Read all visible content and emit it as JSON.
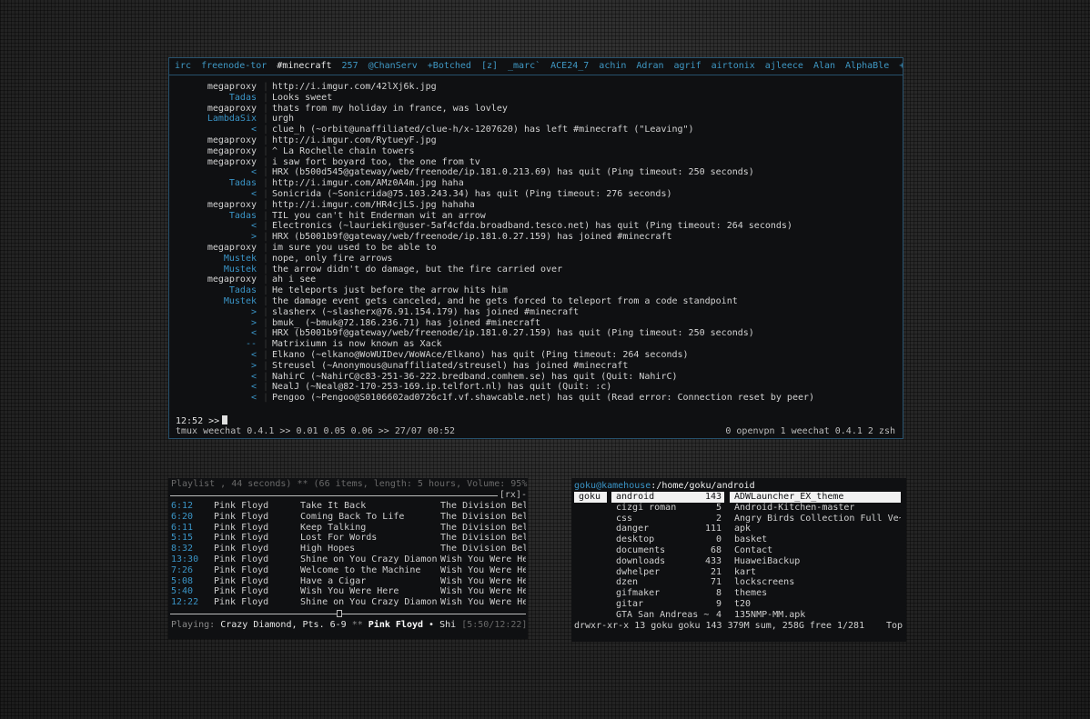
{
  "irc": {
    "topbar": [
      "irc",
      "freenode-tor",
      "#minecraft",
      "257",
      "@ChanServ",
      "+Botched",
      "[z]",
      "_marc`",
      "ACE24_7",
      "achin",
      "Adran",
      "agrif",
      "airtonix",
      "ajleece",
      "Alan",
      "AlphaBle",
      "++"
    ],
    "messages": [
      {
        "nick": "megaproxy",
        "nick_color": "std",
        "msg": "http://i.imgur.com/42lXj6k.jpg",
        "msg_color": "std"
      },
      {
        "nick": "Tadas",
        "nick_color": "blue",
        "msg": "Looks sweet",
        "msg_color": "std"
      },
      {
        "nick": "megaproxy",
        "nick_color": "std",
        "msg": "thats from my holiday in france, was lovley",
        "msg_color": "std"
      },
      {
        "nick": "LambdaSix",
        "nick_color": "blue",
        "msg": "urgh",
        "msg_color": "std"
      },
      {
        "nick": "<",
        "nick_color": "blue",
        "msg": "clue_h (~orbit@unaffiliated/clue-h/x-1207620) has left #minecraft (\"Leaving\")",
        "msg_color": "std"
      },
      {
        "nick": "megaproxy",
        "nick_color": "std",
        "msg": "http://i.imgur.com/RytueyF.jpg",
        "msg_color": "std"
      },
      {
        "nick": "megaproxy",
        "nick_color": "std",
        "msg": "^ La Rochelle chain towers",
        "msg_color": "std"
      },
      {
        "nick": "megaproxy",
        "nick_color": "std",
        "msg": "i saw fort boyard too, the one from tv",
        "msg_color": "std"
      },
      {
        "nick": "<",
        "nick_color": "blue",
        "msg": "HRX (b500d545@gateway/web/freenode/ip.181.0.213.69) has quit (Ping timeout: 250 seconds)",
        "msg_color": "std"
      },
      {
        "nick": "Tadas",
        "nick_color": "blue",
        "msg": "http://i.imgur.com/AMz0A4m.jpg haha",
        "msg_color": "std"
      },
      {
        "nick": "<",
        "nick_color": "blue",
        "msg": "Sonicrida (~Sonicrida@75.103.243.34) has quit (Ping timeout: 276 seconds)",
        "msg_color": "std"
      },
      {
        "nick": "megaproxy",
        "nick_color": "std",
        "msg": "http://i.imgur.com/HR4cjLS.jpg hahaha",
        "msg_color": "std"
      },
      {
        "nick": "Tadas",
        "nick_color": "blue",
        "msg": "TIL you can't hit Enderman wit an arrow",
        "msg_color": "std"
      },
      {
        "nick": "<",
        "nick_color": "blue",
        "msg": "Electronics (~lauriekir@user-5af4cfda.broadband.tesco.net) has quit (Ping timeout: 264 seconds)",
        "msg_color": "std"
      },
      {
        "nick": ">",
        "nick_color": "blue",
        "msg": "HRX (b5001b9f@gateway/web/freenode/ip.181.0.27.159) has joined #minecraft",
        "msg_color": "std"
      },
      {
        "nick": "megaproxy",
        "nick_color": "std",
        "msg": "im sure you used to be able to",
        "msg_color": "std"
      },
      {
        "nick": "Mustek",
        "nick_color": "blue",
        "msg": "nope, only fire arrows",
        "msg_color": "std"
      },
      {
        "nick": "Mustek",
        "nick_color": "blue",
        "msg": "the arrow didn't do damage, but the fire carried over",
        "msg_color": "std"
      },
      {
        "nick": "megaproxy",
        "nick_color": "std",
        "msg": "ah i see",
        "msg_color": "std"
      },
      {
        "nick": "Tadas",
        "nick_color": "blue",
        "msg": "He teleports just before the arrow hits him",
        "msg_color": "std"
      },
      {
        "nick": "Mustek",
        "nick_color": "blue",
        "msg": "the damage event gets canceled, and he gets forced to teleport from a code standpoint",
        "msg_color": "std"
      },
      {
        "nick": ">",
        "nick_color": "blue",
        "msg": "slasherx (~slasherx@76.91.154.179) has joined #minecraft",
        "msg_color": "std"
      },
      {
        "nick": ">",
        "nick_color": "blue",
        "msg": "bmuk_ (~bmuk@72.186.236.71) has joined #minecraft",
        "msg_color": "std"
      },
      {
        "nick": "<",
        "nick_color": "blue",
        "msg": "HRX (b5001b9f@gateway/web/freenode/ip.181.0.27.159) has quit (Ping timeout: 250 seconds)",
        "msg_color": "std"
      },
      {
        "nick": "--",
        "nick_color": "blue",
        "msg": "Matrixiumn is now known as Xack",
        "msg_color": "std"
      },
      {
        "nick": "<",
        "nick_color": "blue",
        "msg": "Elkano (~elkano@WoWUIDev/WoWAce/Elkano) has quit (Ping timeout: 264 seconds)",
        "msg_color": "std"
      },
      {
        "nick": ">",
        "nick_color": "blue",
        "msg": "Streusel (~Anonymous@unaffiliated/streusel) has joined #minecraft",
        "msg_color": "std"
      },
      {
        "nick": "<",
        "nick_color": "blue",
        "msg": "NahirC (~NahirC@c83-251-36-222.bredband.comhem.se) has quit (Quit: NahirC)",
        "msg_color": "std"
      },
      {
        "nick": "<",
        "nick_color": "blue",
        "msg": "NealJ (~Neal@82-170-253-169.ip.telfort.nl) has quit (Quit: :c)",
        "msg_color": "std"
      },
      {
        "nick": "<",
        "nick_color": "blue",
        "msg": "Pengoo (~Pengoo@S0106602ad0726c1f.vf.shawcable.net) has quit (Read error: Connection reset by peer)",
        "msg_color": "std"
      }
    ],
    "input_prompt": "12:52 >>",
    "status_left": "tmux weechat 0.4.1 >> 0.01 0.05 0.06 >> 27/07 00:52",
    "status_right": "0 openvpn 1 weechat 0.4.1 2 zsh"
  },
  "mpd": {
    "header": "Playlist , 44 seconds) ** (66 items, length: 5 hours,  Volume: 95%",
    "rx": "[rx]-",
    "tracks": [
      {
        "time": "6:12",
        "artist": "Pink Floyd",
        "title": "Take It Back",
        "album": "The Division Bel"
      },
      {
        "time": "6:20",
        "artist": "Pink Floyd",
        "title": "Coming Back To Life",
        "album": "The Division Bel"
      },
      {
        "time": "6:11",
        "artist": "Pink Floyd",
        "title": "Keep Talking",
        "album": "The Division Bel"
      },
      {
        "time": "5:15",
        "artist": "Pink Floyd",
        "title": "Lost For Words",
        "album": "The Division Bel"
      },
      {
        "time": "8:32",
        "artist": "Pink Floyd",
        "title": "High Hopes",
        "album": "The Division Bel"
      },
      {
        "time": "13:30",
        "artist": "Pink Floyd",
        "title": "Shine on You Crazy Diamon",
        "album": "Wish You Were He"
      },
      {
        "time": "7:26",
        "artist": "Pink Floyd",
        "title": "Welcome to the Machine",
        "album": "Wish You Were He"
      },
      {
        "time": "5:08",
        "artist": "Pink Floyd",
        "title": "Have a Cigar",
        "album": "Wish You Were He"
      },
      {
        "time": "5:40",
        "artist": "Pink Floyd",
        "title": "Wish You Were Here",
        "album": "Wish You Were He"
      },
      {
        "time": "12:22",
        "artist": "Pink Floyd",
        "title": "Shine on You Crazy Diamon",
        "album": "Wish You Were He"
      }
    ],
    "playing_label": "Playing:",
    "playing_title": "Crazy Diamond, Pts. 6-9",
    "playing_sep": "**",
    "playing_artist": "Pink Floyd",
    "playing_bullet": "•",
    "playing_rest": "Shi",
    "playing_time": "[5:50/12:22]"
  },
  "ranger": {
    "user_host": "goku@kamehouse",
    "path": ":/home/goku/android",
    "col1": [
      "goku"
    ],
    "col2": [
      {
        "name": "android",
        "size": "143"
      },
      {
        "name": "cizgi roman",
        "size": "5"
      },
      {
        "name": "css",
        "size": "2"
      },
      {
        "name": "danger",
        "size": "111"
      },
      {
        "name": "desktop",
        "size": "0"
      },
      {
        "name": "documents",
        "size": "68"
      },
      {
        "name": "downloads",
        "size": "433"
      },
      {
        "name": "dwhelper",
        "size": "21"
      },
      {
        "name": "dzen",
        "size": "71"
      },
      {
        "name": "gifmaker",
        "size": "8"
      },
      {
        "name": "gitar",
        "size": "9"
      },
      {
        "name": "GTA San Andreas ~",
        "size": "4"
      }
    ],
    "col3": [
      "ADWLauncher_EX_theme",
      "Android-Kitchen-master",
      "Angry Birds Collection Full Ve~",
      "apk",
      "basket",
      "Contact",
      "HuaweiBackup",
      "kart",
      "lockscreens",
      "themes",
      "t20",
      "135NMP-MM.apk"
    ],
    "footer_left": "drwxr-xr-x 13 goku goku 143   379M sum, 258G free  1/281",
    "footer_right": "Top"
  },
  "colors": {
    "accent": "#3a94c6",
    "border": "#27516c",
    "background": "#0f1012"
  }
}
